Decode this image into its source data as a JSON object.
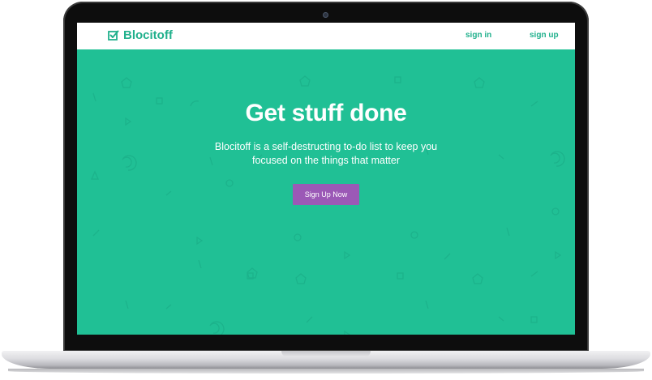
{
  "app": {
    "brand_name": "Blocitoff",
    "brand_icon": "checkbox-icon"
  },
  "nav": {
    "sign_in_label": "sign in",
    "sign_up_label": "sign up"
  },
  "hero": {
    "headline": "Get stuff done",
    "subtext": "Blocitoff is a self-destructing to-do list to keep you focused on the things that matter",
    "cta_label": "Sign Up Now",
    "pattern_icon": "geometric-pattern"
  },
  "colors": {
    "brand_green": "#20b08c",
    "hero_background": "#20c095",
    "cta_purple": "#9b59b6",
    "nav_background": "#ffffff",
    "laptop_bezel": "#0d0d0d"
  }
}
